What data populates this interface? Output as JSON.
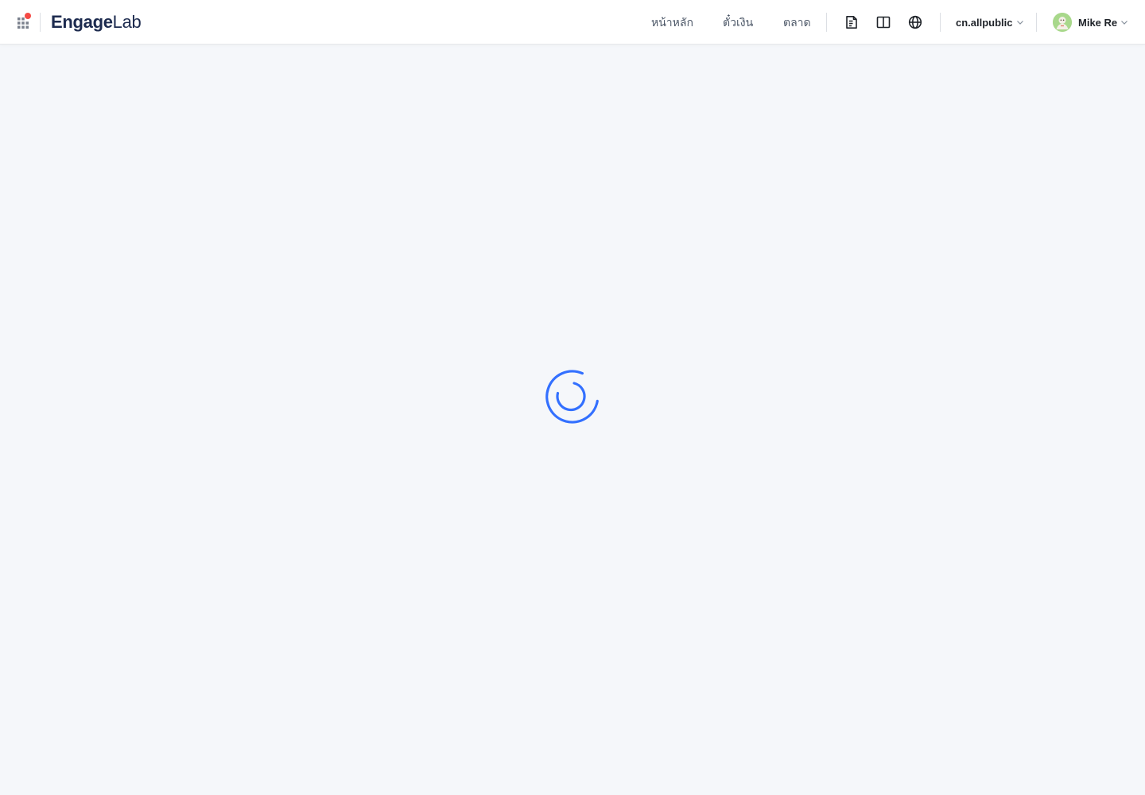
{
  "header": {
    "logo": {
      "primary": "Engage",
      "secondary": "Lab"
    },
    "nav": [
      {
        "label": "หน้าหลัก"
      },
      {
        "label": "ตั๋วเงิน"
      },
      {
        "label": "ตลาด"
      }
    ],
    "tools": [
      {
        "icon": "document-icon"
      },
      {
        "icon": "book-icon"
      },
      {
        "icon": "globe-icon"
      }
    ],
    "account": {
      "label": "cn.allpublic"
    },
    "user": {
      "name": "Mike Re"
    }
  },
  "loading": {
    "icon": "loading-spinner-icon"
  },
  "colors": {
    "accent": "#3370ff",
    "logo_dark": "#1d2b4f",
    "notification": "#f54a45",
    "grid": "#7a808c"
  }
}
